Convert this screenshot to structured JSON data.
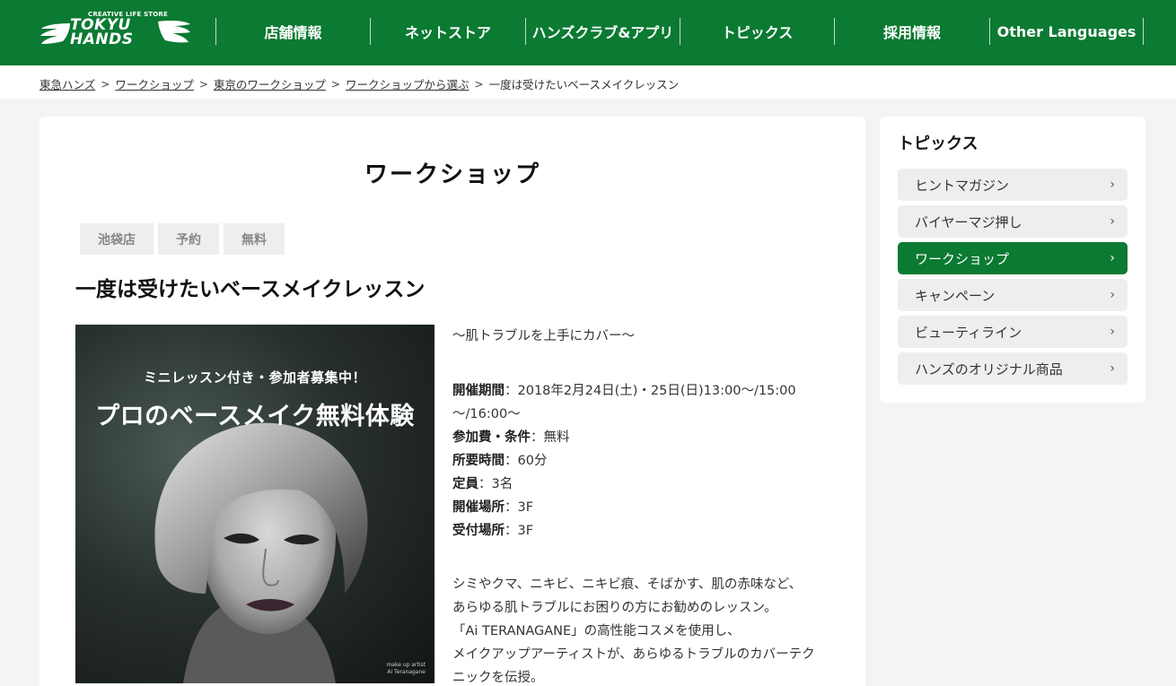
{
  "header": {
    "logo": {
      "tagline": "CREATIVE LIFE STORE",
      "line1": "TOKYU",
      "line2": "HANDS"
    },
    "nav": [
      {
        "label": "店舗情報"
      },
      {
        "label": "ネットストア"
      },
      {
        "label": "ハンズクラブ&アプリ"
      },
      {
        "label": "トピックス"
      },
      {
        "label": "採用情報"
      },
      {
        "label": "Other Languages"
      }
    ]
  },
  "breadcrumb": [
    "東急ハンズ",
    "ワークショップ",
    "東京のワークショップ",
    "ワークショップから選ぶ",
    "一度は受けたいベースメイクレッスン"
  ],
  "breadcrumb_sep": ">",
  "main": {
    "section_title": "ワークショップ",
    "tags": [
      "池袋店",
      "予約",
      "無料"
    ],
    "article_title": "一度は受けたいベースメイクレッスン",
    "hero": {
      "subtitle": "ミニレッスン付き・参加者募集中！",
      "title": "プロのベースメイク無料体験",
      "credit_line1": "make up artist",
      "credit_line2": "Ai Teranagane"
    },
    "lead": "～肌トラブルを上手にカバー～",
    "details": [
      {
        "label": "開催期間",
        "value": "：2018年2月24日(土)・25日(日)13:00～/15:00～/16:00～"
      },
      {
        "label": "参加費・条件",
        "value": "：無料"
      },
      {
        "label": "所要時間",
        "value": "：60分"
      },
      {
        "label": "定員",
        "value": "：3名"
      },
      {
        "label": "開催場所",
        "value": "：3F"
      },
      {
        "label": "受付場所",
        "value": "：3F"
      }
    ],
    "description": [
      "シミやクマ、ニキビ、ニキビ痕、そばかす、肌の赤味など、",
      "あらゆる肌トラブルにお困りの方にお勧めのレッスン。",
      "「Ai TERANAGANE」の高性能コスメを使用し、",
      "メイクアップアーティストが、あらゆるトラブルのカバーテク",
      "ニックを伝授。"
    ]
  },
  "sidebar": {
    "title": "トピックス",
    "items": [
      {
        "label": "ヒントマガジン",
        "active": false
      },
      {
        "label": "バイヤーマジ押し",
        "active": false
      },
      {
        "label": "ワークショップ",
        "active": true
      },
      {
        "label": "キャンペーン",
        "active": false
      },
      {
        "label": "ビューティライン",
        "active": false
      },
      {
        "label": "ハンズのオリジナル商品",
        "active": false
      }
    ],
    "chevron": "›"
  },
  "colors": {
    "brand_green": "#0b7a32",
    "page_bg": "#f4f4f2"
  },
  "icons": {
    "logo_wings": "wing-icon",
    "chevron": "chevron-right-icon"
  }
}
